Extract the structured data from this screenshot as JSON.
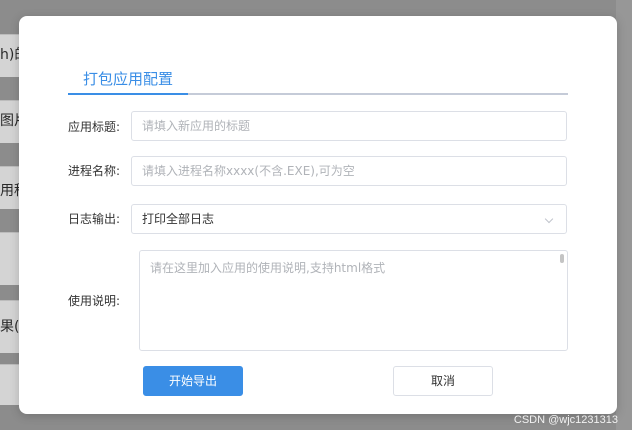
{
  "background": {
    "fragments": [
      "h)的",
      "图片",
      "用程",
      "果(I"
    ]
  },
  "dialog": {
    "tab_title": "打包应用配置",
    "fields": {
      "app_title": {
        "label": "应用标题:",
        "placeholder": "请填入新应用的标题"
      },
      "process_name": {
        "label": "进程名称:",
        "placeholder": "请填入进程名称xxxx(不含.EXE),可为空"
      },
      "log_output": {
        "label": "日志输出:",
        "value": "打印全部日志"
      },
      "usage": {
        "label": "使用说明:",
        "placeholder": "请在这里加入应用的使用说明,支持html格式"
      }
    },
    "buttons": {
      "export": "开始导出",
      "cancel": "取消"
    }
  },
  "watermark": "CSDN @wjc1231313",
  "colors": {
    "accent": "#3a8ee6",
    "overlay": "#8c8c8c",
    "border": "#dcdfe6"
  }
}
